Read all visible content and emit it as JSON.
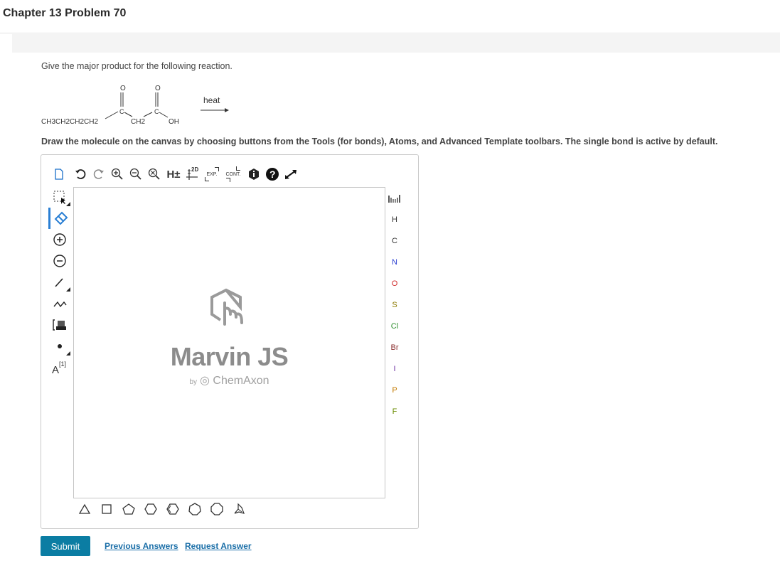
{
  "header": {
    "title": "Chapter 13 Problem 70"
  },
  "question": {
    "prompt": "Give the major product for the following reaction.",
    "instructions": "Draw the molecule on the canvas by choosing buttons from the Tools (for bonds), Atoms, and Advanced Template toolbars. The single bond is active by default."
  },
  "reaction": {
    "reagent": "CH3CH2CH2CH2",
    "middle": "CH2",
    "oh": "OH",
    "carbon": "C",
    "oxygen": "O",
    "condition": "heat"
  },
  "editor": {
    "top_toolbar": {
      "h_label": "H±",
      "twod": "2D",
      "exp": "EXP.",
      "cont": "CONT."
    },
    "watermark": {
      "title": "Marvin JS",
      "by": "by",
      "brand": "ChemAxon"
    },
    "atoms": [
      {
        "symbol": "H",
        "color": "#333333"
      },
      {
        "symbol": "C",
        "color": "#333333"
      },
      {
        "symbol": "N",
        "color": "#2a3fd1"
      },
      {
        "symbol": "O",
        "color": "#d12a2a"
      },
      {
        "symbol": "S",
        "color": "#8c7a00"
      },
      {
        "symbol": "Cl",
        "color": "#2a8c2a"
      },
      {
        "symbol": "Br",
        "color": "#8b2f2f"
      },
      {
        "symbol": "I",
        "color": "#6a2aa0"
      },
      {
        "symbol": "P",
        "color": "#c47a00"
      },
      {
        "symbol": "F",
        "color": "#6a8c00"
      }
    ],
    "atom_label_sup": "[1]",
    "atom_label": "A"
  },
  "actions": {
    "submit": "Submit",
    "previous_answers": "Previous Answers",
    "request_answer": "Request Answer"
  }
}
